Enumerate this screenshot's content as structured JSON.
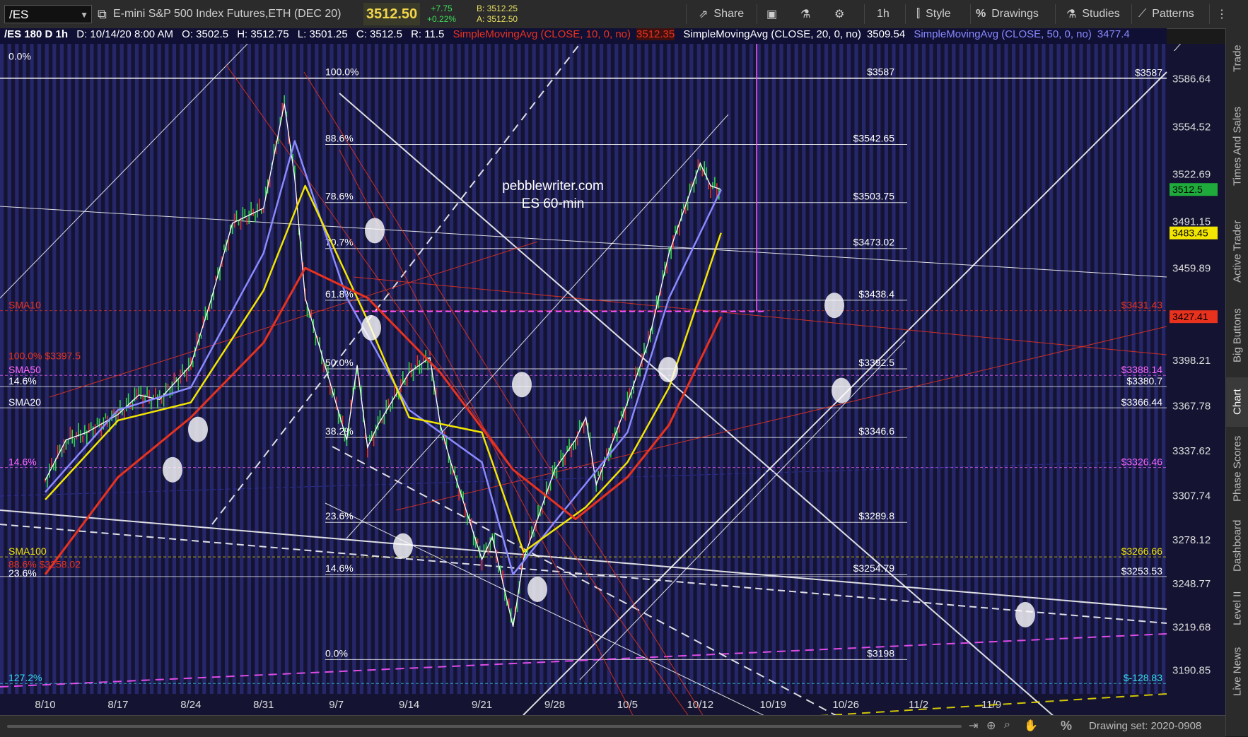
{
  "toolbar": {
    "symbol": "/ES",
    "instrument": "E-mini S&P 500 Index Futures,ETH (DEC 20)",
    "last": "3512.50",
    "change": "+7.75",
    "change_pct": "+0.22%",
    "bid": "B: 3512.25",
    "ask": "A: 3512.50",
    "share": "Share",
    "timeframe": "1h",
    "style": "Style",
    "drawings": "Drawings",
    "studies": "Studies",
    "patterns": "Patterns"
  },
  "header": {
    "symbol": "/ES 180 D 1h",
    "date": "D: 10/14/20 8:00 AM",
    "open": "O: 3502.5",
    "high": "H: 3512.75",
    "low": "L: 3501.25",
    "close": "C: 3512.5",
    "range": "R: 11.5",
    "sma10_label": "SimpleMovingAvg (CLOSE, 10, 0, no)",
    "sma10_value": "3512.35",
    "sma20_label": "SimpleMovingAvg (CLOSE, 20, 0, no)",
    "sma20_value": "3509.54",
    "sma50_label": "SimpleMovingAvg (CLOSE, 50, 0, no)",
    "sma50_value": "3477.4"
  },
  "chart_data": {
    "type": "candlestick",
    "title": "pebblewriter.com",
    "subtitle": "ES  60-min",
    "x_ticks": [
      "8/10",
      "8/17",
      "8/24",
      "8/31",
      "9/7",
      "9/14",
      "9/21",
      "9/28",
      "10/5",
      "10/12",
      "10/19",
      "10/26",
      "11/2",
      "11/9"
    ],
    "y_ticks": [
      "3586.64",
      "3554.52",
      "3522.69",
      "3491.15",
      "3459.89",
      "3398.21",
      "3367.78",
      "3337.62",
      "3307.74",
      "3278.12",
      "3248.77",
      "3219.68",
      "3190.85"
    ],
    "ylim": [
      3175,
      3610
    ],
    "price_badges": [
      {
        "label": "3512.5",
        "value": 3512.5,
        "color": "#1faa3c"
      },
      {
        "label": "3483.45",
        "value": 3483.45,
        "color": "#f2e600"
      },
      {
        "label": "3427.41",
        "value": 3427.41,
        "color": "#e8321e"
      }
    ],
    "close_path": [
      [
        "8/10",
        3318
      ],
      [
        "8/12",
        3345
      ],
      [
        "8/14",
        3350
      ],
      [
        "8/17",
        3362
      ],
      [
        "8/19",
        3375
      ],
      [
        "8/21",
        3372
      ],
      [
        "8/24",
        3395
      ],
      [
        "8/26",
        3440
      ],
      [
        "8/28",
        3490
      ],
      [
        "8/31",
        3500
      ],
      [
        "9/2",
        3570
      ],
      [
        "9/3",
        3520
      ],
      [
        "9/4",
        3440
      ],
      [
        "9/8",
        3345
      ],
      [
        "9/9",
        3395
      ],
      [
        "9/10",
        3340
      ],
      [
        "9/11",
        3355
      ],
      [
        "9/14",
        3390
      ],
      [
        "9/16",
        3400
      ],
      [
        "9/17",
        3355
      ],
      [
        "9/18",
        3330
      ],
      [
        "9/21",
        3265
      ],
      [
        "9/22",
        3280
      ],
      [
        "9/24",
        3220
      ],
      [
        "9/25",
        3265
      ],
      [
        "9/28",
        3325
      ],
      [
        "9/30",
        3345
      ],
      [
        "10/1",
        3360
      ],
      [
        "10/2",
        3315
      ],
      [
        "10/5",
        3370
      ],
      [
        "10/7",
        3410
      ],
      [
        "10/9",
        3470
      ],
      [
        "10/12",
        3530
      ],
      [
        "10/13",
        3515
      ],
      [
        "10/14",
        3512.5
      ]
    ],
    "sma10": [
      [
        "8/10",
        3310
      ],
      [
        "8/17",
        3365
      ],
      [
        "8/24",
        3380
      ],
      [
        "8/31",
        3470
      ],
      [
        "9/3",
        3545
      ],
      [
        "9/8",
        3440
      ],
      [
        "9/14",
        3365
      ],
      [
        "9/21",
        3330
      ],
      [
        "9/24",
        3255
      ],
      [
        "9/28",
        3290
      ],
      [
        "10/5",
        3350
      ],
      [
        "10/9",
        3440
      ],
      [
        "10/14",
        3512.35
      ]
    ],
    "sma20": [
      [
        "8/10",
        3305
      ],
      [
        "8/17",
        3358
      ],
      [
        "8/24",
        3370
      ],
      [
        "8/31",
        3445
      ],
      [
        "9/4",
        3515
      ],
      [
        "9/10",
        3425
      ],
      [
        "9/14",
        3360
      ],
      [
        "9/21",
        3350
      ],
      [
        "9/25",
        3270
      ],
      [
        "10/1",
        3300
      ],
      [
        "10/5",
        3330
      ],
      [
        "10/9",
        3380
      ],
      [
        "10/14",
        3483.45
      ]
    ],
    "sma50": [
      [
        "8/10",
        3255
      ],
      [
        "8/17",
        3320
      ],
      [
        "8/24",
        3360
      ],
      [
        "8/31",
        3410
      ],
      [
        "9/4",
        3460
      ],
      [
        "9/10",
        3440
      ],
      [
        "9/17",
        3390
      ],
      [
        "9/24",
        3325
      ],
      [
        "9/30",
        3292
      ],
      [
        "10/5",
        3320
      ],
      [
        "10/9",
        3355
      ],
      [
        "10/14",
        3427.41
      ]
    ],
    "fib_left": [
      {
        "pct": "100.0%",
        "value": 3587
      },
      {
        "pct": "88.6%",
        "value": 3542.65
      },
      {
        "pct": "78.6%",
        "value": 3503.75
      },
      {
        "pct": "70.7%",
        "value": 3473.02
      },
      {
        "pct": "61.8%",
        "value": 3438.4
      },
      {
        "pct": "50.0%",
        "value": 3392.5
      },
      {
        "pct": "38.2%",
        "value": 3346.6
      },
      {
        "pct": "23.6%",
        "value": 3289.8
      },
      {
        "pct": "14.6%",
        "value": 3254.79
      },
      {
        "pct": "0.0%",
        "value": 3198
      }
    ],
    "fib_price_labels": [
      "$3587",
      "$3542.65",
      "$3503.75",
      "$3473.02",
      "$3438.4",
      "$3392.5",
      "$3346.6",
      "$3289.8",
      "$3254.79",
      "$3198"
    ],
    "right_labels": [
      {
        "text": "$3587",
        "value": 3587,
        "color": "#ffffff"
      },
      {
        "text": "$3431.43",
        "value": 3431.43,
        "color": "#e8321e"
      },
      {
        "text": "$3388.14",
        "value": 3388.14,
        "color": "#ff66ff"
      },
      {
        "text": "$3380.7",
        "value": 3380.7,
        "color": "#ffffff"
      },
      {
        "text": "$3366.44",
        "value": 3366.44,
        "color": "#ffffff"
      },
      {
        "text": "$3326.46",
        "value": 3326.46,
        "color": "#ff66ff"
      },
      {
        "text": "$3266.66",
        "value": 3266.66,
        "color": "#f2e600"
      },
      {
        "text": "$3253.53",
        "value": 3253.53,
        "color": "#ffffff"
      },
      {
        "text": "$-128.83",
        "value": 3182,
        "color": "#33ddee"
      }
    ],
    "left_labels": [
      {
        "text": "0.0%",
        "value": 3598,
        "color": "#ffffff"
      },
      {
        "text": "SMA10",
        "value": 3431.43,
        "color": "#e8321e"
      },
      {
        "text": "100.0%  $3397.5",
        "value": 3397.5,
        "color": "#e8321e"
      },
      {
        "text": "SMA50",
        "value": 3388.14,
        "color": "#ff66ff"
      },
      {
        "text": "14.6%",
        "value": 3380.7,
        "color": "#ffffff"
      },
      {
        "text": "SMA20",
        "value": 3366.44,
        "color": "#ffffff"
      },
      {
        "text": "14.6%",
        "value": 3326.46,
        "color": "#ff66ff"
      },
      {
        "text": "SMA100",
        "value": 3266.66,
        "color": "#f2e600"
      },
      {
        "text": "88.6%  $3258.02",
        "value": 3258.02,
        "color": "#e8321e"
      },
      {
        "text": "23.6%",
        "value": 3252,
        "color": "#ffffff"
      },
      {
        "text": "127.2%",
        "value": 3182,
        "color": "#33ddee"
      }
    ]
  },
  "side_tabs": [
    "Trade",
    "Times And Sales",
    "Active Trader",
    "Big Buttons",
    "Chart",
    "Phase Scores",
    "Dashboard",
    "Level II",
    "Live News"
  ],
  "bottom": {
    "drawing_set": "Drawing set: 2020-0908"
  }
}
